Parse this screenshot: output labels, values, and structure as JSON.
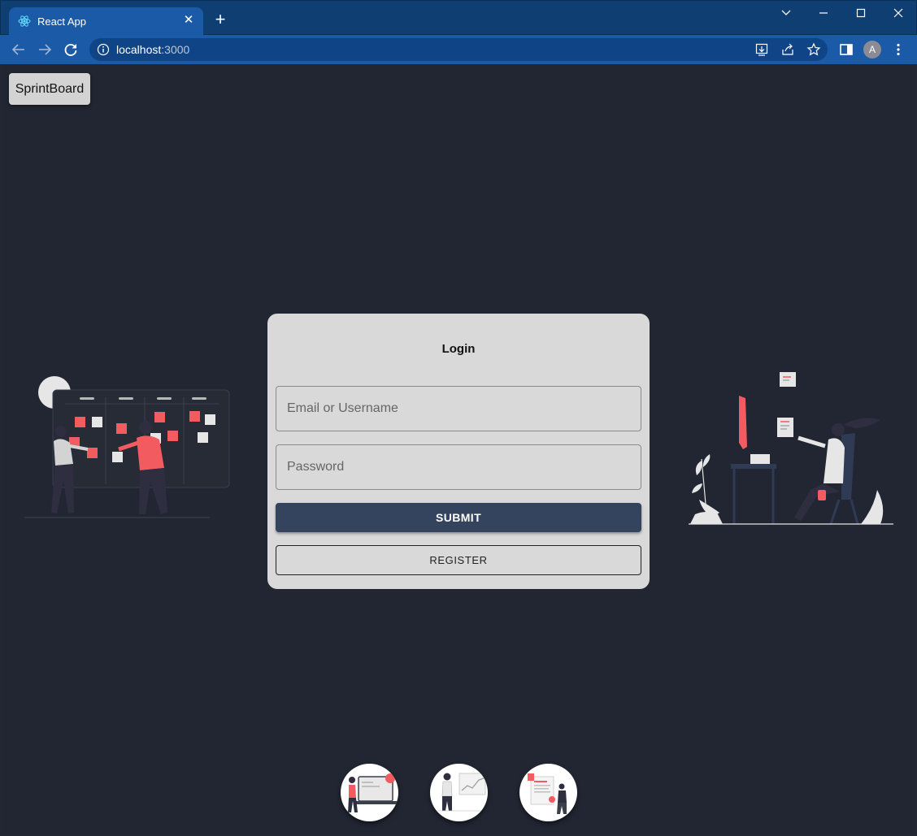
{
  "browser": {
    "tab_title": "React App",
    "tab_close": "✕",
    "new_tab": "+",
    "url_host": "localhost",
    "url_port": ":3000",
    "avatar_initial": "A"
  },
  "app": {
    "brand": "SprintBoard"
  },
  "login": {
    "title": "Login",
    "username_placeholder": "Email or Username",
    "password_placeholder": "Password",
    "submit_label": "SUBMIT",
    "register_label": "REGISTER"
  },
  "colors": {
    "page_bg": "#222632",
    "card_bg": "#d9d9d9",
    "primary_button": "#34445e",
    "accent": "#f25b5f"
  },
  "icons": {
    "tab_favicon": "react-logo-icon",
    "back": "arrow-left-icon",
    "forward": "arrow-right-icon",
    "reload": "reload-icon",
    "info": "info-icon",
    "install": "install-icon",
    "share": "share-icon",
    "bookmark": "star-icon",
    "sidepanel": "side-panel-icon",
    "menu": "kebab-menu-icon"
  }
}
